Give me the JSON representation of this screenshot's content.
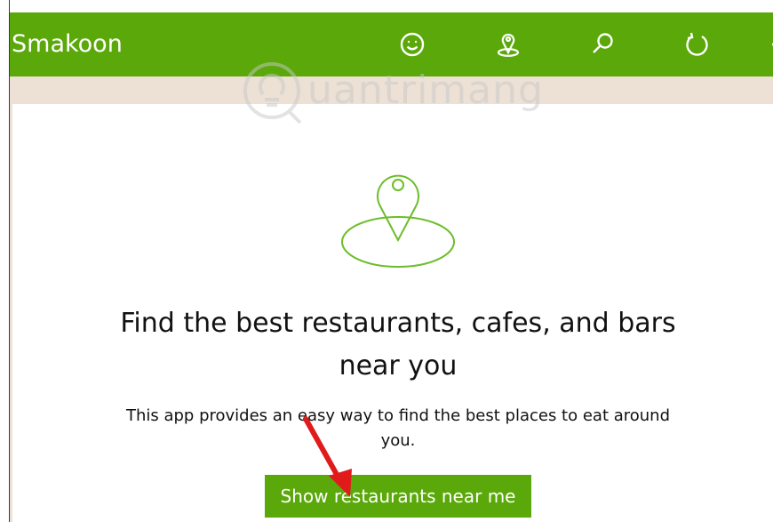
{
  "app": {
    "title": "Smakoon"
  },
  "toolbar": {
    "icons": [
      "smiley-icon",
      "location-pin-icon",
      "search-icon",
      "refresh-icon",
      "more-icon"
    ]
  },
  "main": {
    "headline_line1": "Find the best restaurants, cafes, and bars",
    "headline_line2": "near you",
    "subtext_line1": "This app provides an easy way to find the best places to eat around",
    "subtext_line2": "you.",
    "cta_label": "Show restaurants near me"
  },
  "watermark": {
    "text": "uantrimang"
  },
  "colors": {
    "accent": "#5aa80a",
    "band": "#ede0d4",
    "annotation_arrow": "#e01b1b"
  }
}
